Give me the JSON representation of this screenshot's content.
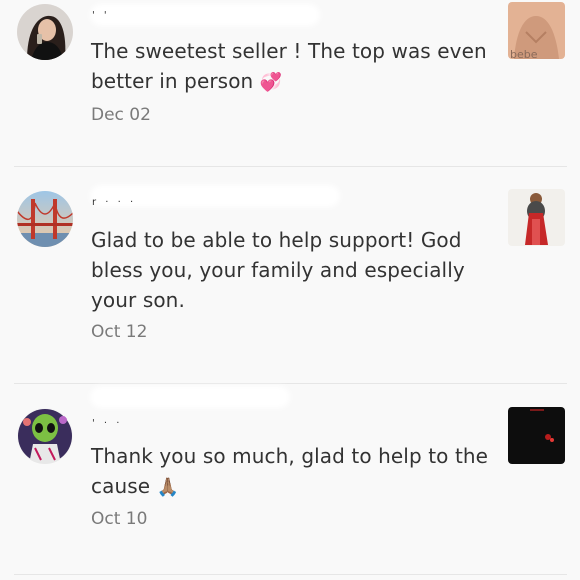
{
  "reviews": [
    {
      "text": "The sweetest seller ! The top was even better in person",
      "emoji": "💞",
      "date": "Dec 02",
      "name_partial": "' '",
      "thumb_watermark": "bebe"
    },
    {
      "text": "Glad to be able to help support! God bless you, your family and especially your son.",
      "emoji": "",
      "date": "Oct 12",
      "name_partial": "r · · ·"
    },
    {
      "text": "Thank you so much, glad to help to the cause",
      "emoji": "🙏🏽",
      "date": "Oct 10",
      "name_partial": "' · ·"
    }
  ],
  "icons": {
    "avatar1": "user-photo-avatar",
    "avatar2": "golden-gate-bridge-avatar",
    "avatar3": "alien-cartoon-avatar",
    "thumb1": "product-top-thumbnail",
    "thumb2": "product-figure-thumbnail",
    "thumb3": "product-dark-thumbnail"
  }
}
